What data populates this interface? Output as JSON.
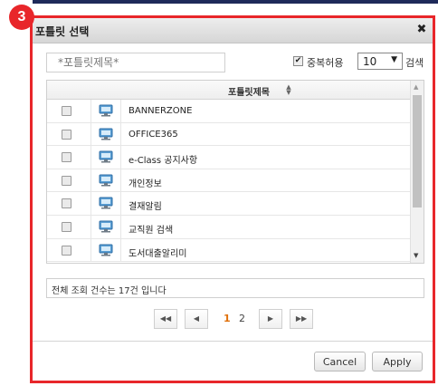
{
  "badge": "3",
  "dialog": {
    "title": "포틀릿 선택",
    "close_glyph": "✖"
  },
  "search": {
    "placeholder": "*포틀릿제목*",
    "value": ""
  },
  "options": {
    "check_glyph": "✔",
    "duplicate_allow_label": "중복허용",
    "duplicate_allow_checked": true,
    "page_size_value": "10",
    "page_size_arrow": "▼",
    "search_button_label": "검색"
  },
  "grid": {
    "column_header": "포틀릿제목",
    "sort_glyph_up": "▲",
    "sort_glyph_down": "▼",
    "rows": [
      {
        "title": "BANNERZONE"
      },
      {
        "title": "OFFICE365"
      },
      {
        "title": "e-Class 공지사항"
      },
      {
        "title": "개인정보"
      },
      {
        "title": "결재알림"
      },
      {
        "title": "교직원 검색"
      },
      {
        "title": "도서대출알리미"
      }
    ],
    "scroll_up_glyph": "▲",
    "scroll_down_glyph": "▼"
  },
  "status": {
    "total_count_text": "전체 조회 건수는 17건 입니다"
  },
  "pagination": {
    "first_glyph": "◀◀",
    "prev_glyph": "◀",
    "next_glyph": "▶",
    "last_glyph": "▶▶",
    "pages": [
      "1",
      "2"
    ],
    "current_page": "1"
  },
  "footer": {
    "cancel_label": "Cancel",
    "apply_label": "Apply"
  },
  "colors": {
    "highlight_border": "#e8262a",
    "current_page": "#e0700a",
    "top_accent": "#1e2a5a"
  }
}
